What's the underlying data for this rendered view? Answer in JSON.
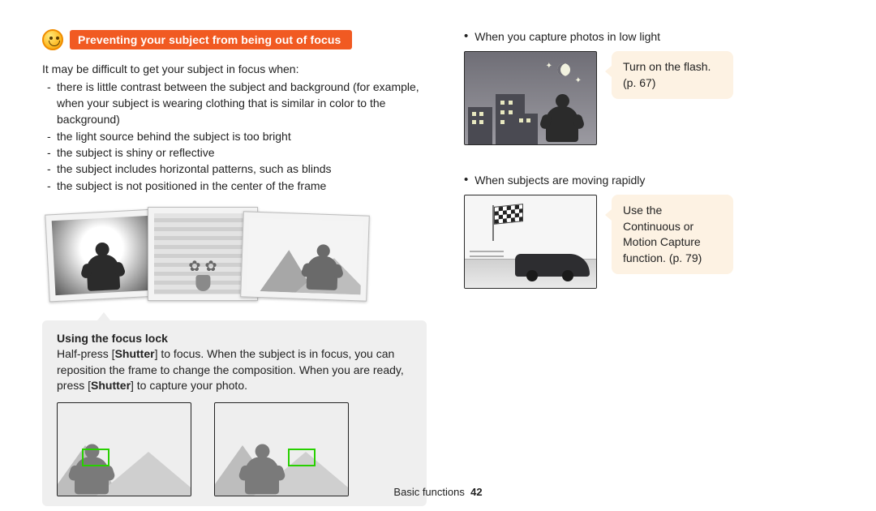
{
  "section_title": "Preventing your subject from being out of focus",
  "intro": "It may be difficult to get your subject in focus when:",
  "focus_difficulties": [
    "there is little contrast between the subject and background (for example, when your subject is wearing clothing that is similar in color to the background)",
    "the light source behind the subject is too bright",
    "the subject is shiny or reflective",
    "the subject includes horizontal patterns, such as blinds",
    "the subject is not positioned in the center of the frame"
  ],
  "focus_lock": {
    "title": "Using the focus lock",
    "text_before_shutter1": "Half-press [",
    "shutter1": "Shutter",
    "text_mid": "] to focus. When the subject is in focus, you can reposition the frame to change the composition. When you are ready, press [",
    "shutter2": "Shutter",
    "text_after": "] to capture your photo."
  },
  "tips": {
    "low_light": {
      "heading": "When you capture photos in low light",
      "tip": "Turn on the flash. (p. 67)"
    },
    "moving": {
      "heading": "When subjects are moving rapidly",
      "tip": "Use the Continuous or Motion Capture function. (p. 79)"
    }
  },
  "footer": {
    "section": "Basic functions",
    "page": "42"
  },
  "colors": {
    "accent": "#f15a22",
    "tip_bg": "#fdf2e3",
    "callout_bg": "#efefef",
    "focus_box": "#28d000"
  }
}
